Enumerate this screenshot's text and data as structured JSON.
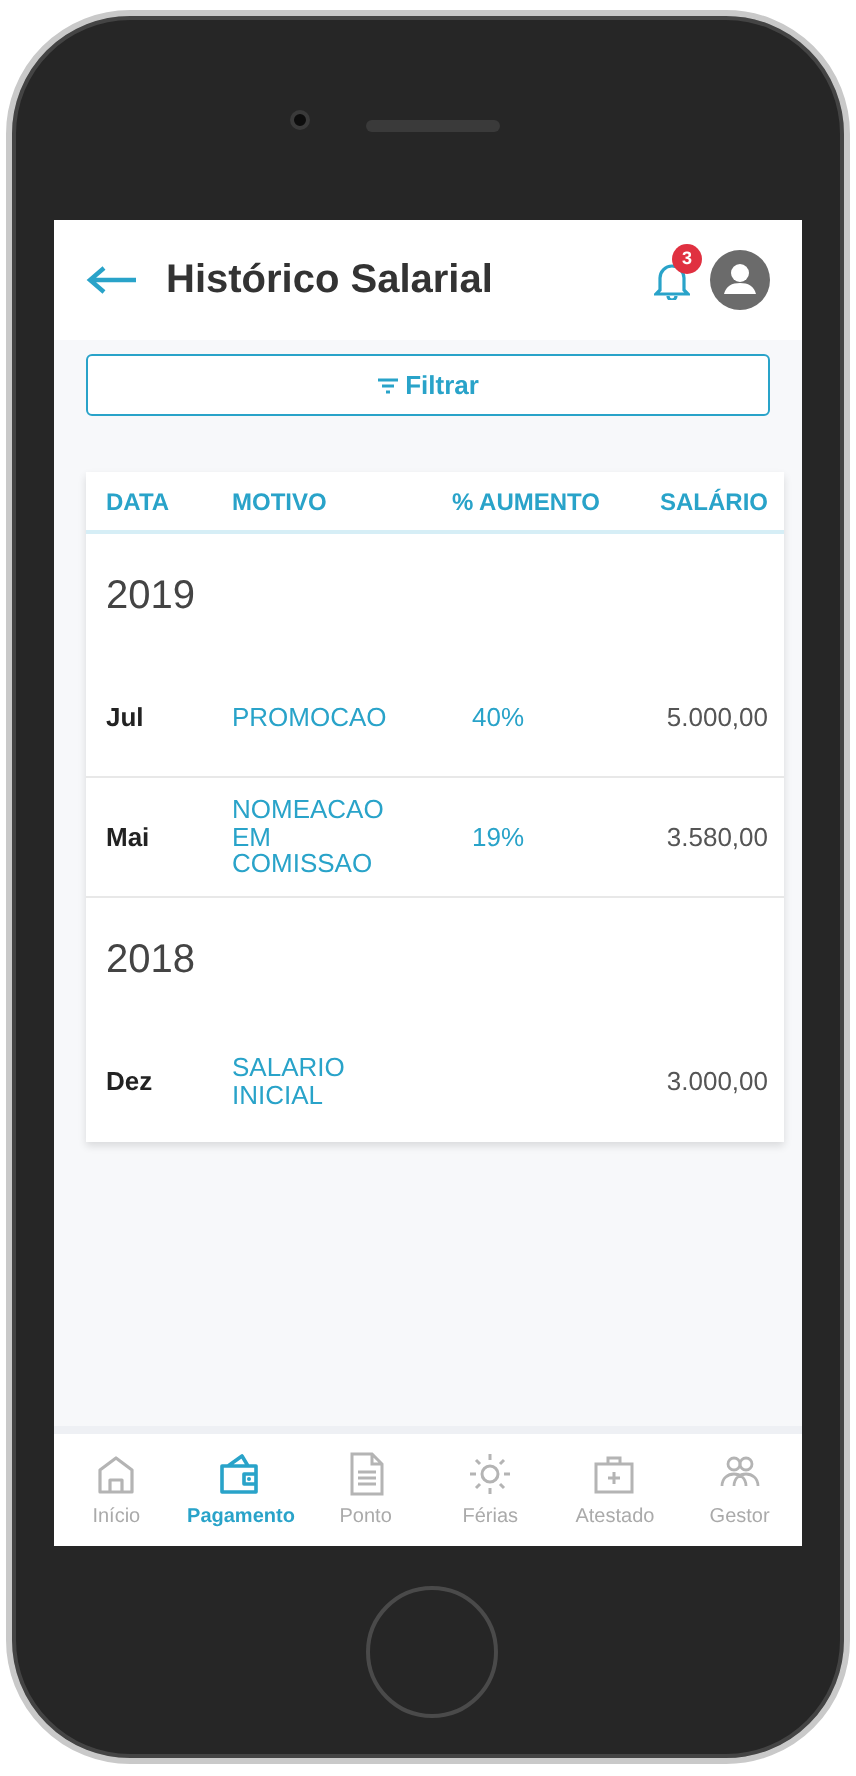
{
  "header": {
    "title": "Histórico Salarial",
    "notification_count": "3"
  },
  "filter_button": {
    "label": "Filtrar"
  },
  "table": {
    "columns": [
      "DATA",
      "MOTIVO",
      "% AUMENTO",
      "SALÁRIO"
    ],
    "groups": [
      {
        "year": "2019",
        "rows": [
          {
            "month": "Jul",
            "reason": "PROMOCAO",
            "increase": "40%",
            "salary": "5.000,00"
          },
          {
            "month": "Mai",
            "reason": "NOMEACAO EM COMISSAO",
            "increase": "19%",
            "salary": "3.580,00"
          }
        ]
      },
      {
        "year": "2018",
        "rows": [
          {
            "month": "Dez",
            "reason": "SALARIO INICIAL",
            "salary": "3.000,00"
          }
        ]
      }
    ]
  },
  "bottom_nav": [
    {
      "kind": "home",
      "label": "Início",
      "selected": false
    },
    {
      "kind": "wallet",
      "label": "Pagamento",
      "selected": true
    },
    {
      "kind": "document",
      "label": "Ponto",
      "selected": false
    },
    {
      "kind": "sun",
      "label": "Férias",
      "selected": false
    },
    {
      "kind": "medkit",
      "label": "Atestado",
      "selected": false
    },
    {
      "kind": "people",
      "label": "Gestor",
      "selected": false
    }
  ]
}
